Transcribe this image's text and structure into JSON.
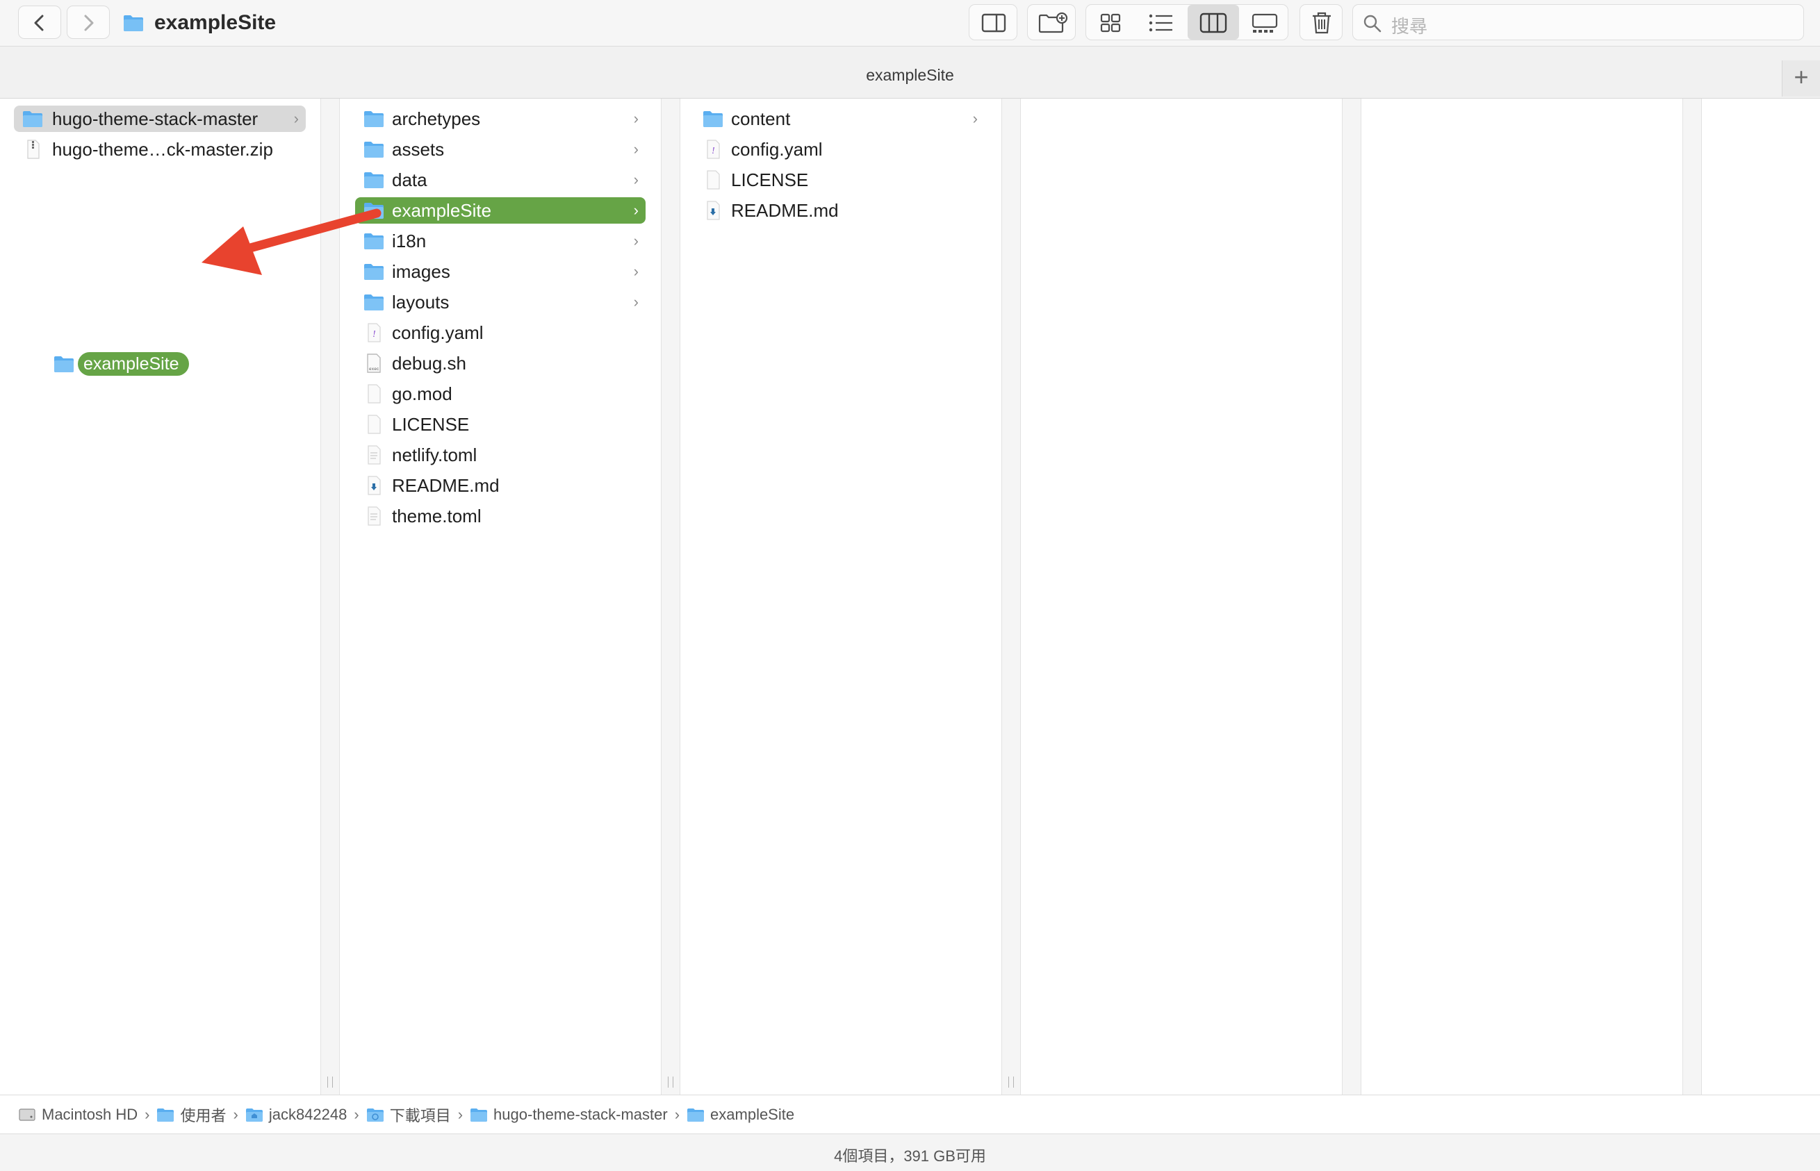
{
  "window": {
    "title": "exampleSite",
    "search_placeholder": "搜尋"
  },
  "tab": {
    "title": "exampleSite",
    "add_label": "+"
  },
  "columns": [
    {
      "items": [
        {
          "label": "hugo-theme-stack-master",
          "type": "folder",
          "selected": "gray",
          "has_children": true
        },
        {
          "label": "hugo-theme…ck-master.zip",
          "type": "zip"
        }
      ]
    },
    {
      "items": [
        {
          "label": "archetypes",
          "type": "folder",
          "has_children": true
        },
        {
          "label": "assets",
          "type": "folder",
          "has_children": true
        },
        {
          "label": "data",
          "type": "folder",
          "has_children": true
        },
        {
          "label": "exampleSite",
          "type": "folder",
          "selected": "green",
          "has_children": true
        },
        {
          "label": "i18n",
          "type": "folder",
          "has_children": true
        },
        {
          "label": "images",
          "type": "folder",
          "has_children": true
        },
        {
          "label": "layouts",
          "type": "folder",
          "has_children": true
        },
        {
          "label": "config.yaml",
          "type": "yaml"
        },
        {
          "label": "debug.sh",
          "type": "script"
        },
        {
          "label": "go.mod",
          "type": "file"
        },
        {
          "label": "LICENSE",
          "type": "file"
        },
        {
          "label": "netlify.toml",
          "type": "text"
        },
        {
          "label": "README.md",
          "type": "markdown"
        },
        {
          "label": "theme.toml",
          "type": "text"
        }
      ]
    },
    {
      "items": [
        {
          "label": "content",
          "type": "folder",
          "has_children": true
        },
        {
          "label": "config.yaml",
          "type": "yaml"
        },
        {
          "label": "LICENSE",
          "type": "file"
        },
        {
          "label": "README.md",
          "type": "markdown"
        }
      ]
    }
  ],
  "drag_ghost": {
    "label": "exampleSite"
  },
  "path": [
    {
      "label": "Macintosh HD",
      "icon": "hard-drive-icon"
    },
    {
      "label": "使用者",
      "icon": "folder-icon"
    },
    {
      "label": "jack842248",
      "icon": "home-folder-icon"
    },
    {
      "label": "下載項目",
      "icon": "downloads-folder-icon"
    },
    {
      "label": "hugo-theme-stack-master",
      "icon": "folder-icon"
    },
    {
      "label": "exampleSite",
      "icon": "folder-icon"
    }
  ],
  "status": {
    "text": "4個項目，391 GB可用"
  },
  "colors": {
    "selection_green": "#66a446",
    "selection_gray": "#d9d9d9",
    "folder_blue": "#5aaef0",
    "arrow_red": "#e8432e"
  }
}
